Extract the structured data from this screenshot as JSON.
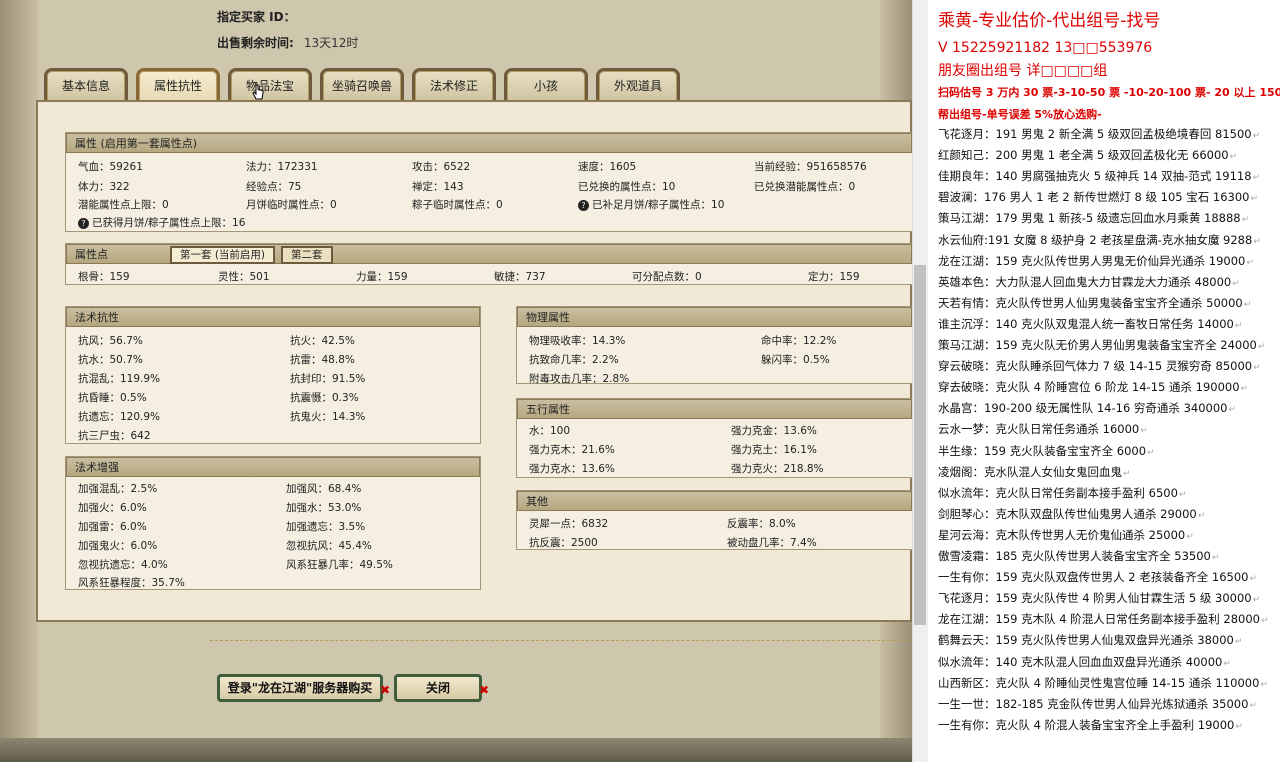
{
  "header": {
    "buyer_label": "指定买家 ID：",
    "remaining_label": "出售剩余时间:",
    "remaining_value": "13天12时"
  },
  "tabs": [
    "基本信息",
    "属性抗性",
    "物品法宝",
    "坐骑召唤兽",
    "法术修正",
    "小孩",
    "外观道具"
  ],
  "attrs": {
    "title": "属性 (启用第一套属性点)",
    "rows": [
      [
        "气血：59261",
        "法力：172331",
        "攻击：6522",
        "速度：1605",
        "当前经验：951658576"
      ],
      [
        "体力：322",
        "经验点：75",
        "禅定：143",
        "已兑换的属性点：10",
        "已兑换潜能属性点：0"
      ],
      [
        "潜能属性点上限：0",
        "月饼临时属性点：0",
        "粽子临时属性点：0",
        "已补足月饼/粽子属性点：10",
        ""
      ]
    ],
    "note": "已获得月饼/粽子属性点上限：16"
  },
  "points": {
    "title": "属性点",
    "tab1": "第一套 (当前启用)",
    "tab2": "第二套",
    "row": [
      "根骨：159",
      "灵性：501",
      "力量：159",
      "敏捷：737",
      "可分配点数：0",
      "定力：159"
    ]
  },
  "resist": {
    "title": "法术抗性",
    "items": [
      [
        "抗风：56.7%",
        "抗火：42.5%"
      ],
      [
        "抗水：50.7%",
        "抗雷：48.8%"
      ],
      [
        "抗混乱：119.9%",
        "抗封印：91.5%"
      ],
      [
        "抗昏睡：0.5%",
        "抗震慑：0.3%"
      ],
      [
        "抗遗忘：120.9%",
        "抗鬼火：14.3%"
      ],
      [
        "抗三尸虫：642",
        ""
      ]
    ]
  },
  "boost": {
    "title": "法术增强",
    "items": [
      [
        "加强混乱：2.5%",
        "加强风：68.4%"
      ],
      [
        "加强火：6.0%",
        "加强水：53.0%"
      ],
      [
        "加强雷：6.0%",
        "加强遗忘：3.5%"
      ],
      [
        "加强鬼火：6.0%",
        "忽视抗风：45.4%"
      ],
      [
        "忽视抗遗忘：4.0%",
        "风系狂暴几率：49.5%"
      ],
      [
        "风系狂暴程度：35.7%",
        ""
      ]
    ]
  },
  "physical": {
    "title": "物理属性",
    "items": [
      [
        "物理吸收率：14.3%",
        "命中率：12.2%"
      ],
      [
        "抗致命几率：2.2%",
        "躲闪率：0.5%"
      ],
      [
        "附毒攻击几率：2.8%",
        ""
      ]
    ]
  },
  "wuxing": {
    "title": "五行属性",
    "items": [
      [
        "水：100",
        "强力克金：13.6%"
      ],
      [
        "强力克木：21.6%",
        "强力克土：16.1%"
      ],
      [
        "强力克水：13.6%",
        "强力克火：218.8%"
      ]
    ]
  },
  "other": {
    "title": "其他",
    "items": [
      [
        "灵犀一点：6832",
        "反震率：8.0%"
      ],
      [
        "抗反震：2500",
        "被动盘几率：7.4%"
      ]
    ]
  },
  "buttons": {
    "login": "登录\"龙在江湖\"服务器购买",
    "close": "关闭"
  },
  "chat": {
    "header": "乘黄-专业估价-代出组号-找号",
    "phone": "V 15225921182  13□□553976",
    "line3": "朋友圈出组号   详□□□□组",
    "line4": "扫码估号 3 万内 30 票-3-10-50 票  -10-20-100 票- 20 以上 150",
    "line5": "帮出组号-单号误差 5%放心选购-",
    "entries": [
      "飞花逐月：191 男鬼 2 新全满 5 级双回孟极绝境春回 81500",
      "红颜知己：200 男鬼 1 老全满 5 级双回孟极化无 66000",
      "佳期良年：140 男腐强抽克火 5 级神兵 14 双抽-范式 19118",
      "碧波澜：176 男人 1 老 2 新传世燃灯 8 级 105 宝石 16300",
      "策马江湖：179 男鬼 1 新孩-5 级遗忘回血水月乘黄 18888",
      "水云仙府:191 女魔 8 级护身 2 老孩星盘满-克水抽女魔 9288",
      "龙在江湖：159 克火队传世男人男鬼无价仙异光通杀 19000",
      "英雄本色：大力队混人回血鬼大力甘霖龙大力通杀 48000",
      "天若有情：克火队传世男人仙男鬼装备宝宝齐全通杀 50000",
      "谁主沉浮：140 克火队双鬼混人统一畜牧日常任务 14000",
      "策马江湖：159 克火队无价男人男仙男鬼装备宝宝齐全 24000",
      "穿云破晓：克火队睡杀回气体力 7 级 14-15 灵猴穷奇 85000",
      "穿去破晓：克火队 4 阶睡宫位 6 阶龙 14-15 通杀 190000",
      "水晶宫：190-200 级无属性队 14-16 穷奇通杀 340000",
      "云水一梦：克火队日常任务通杀 16000",
      "半生缘：159 克火队装备宝宝齐全 6000",
      "凌烟阁：克水队混人女仙女鬼回血鬼",
      "似水流年：克火队日常任务副本接手盈利 6500",
      "剑胆琴心：克木队双盘队传世仙鬼男人通杀 29000",
      "星河云海：克木队传世男人无价鬼仙通杀 25000",
      "傲雪凌霜：185 克火队传世男人装备宝宝齐全 53500",
      "一生有你：159 克火队双盘传世男人 2 老孩装备齐全 16500",
      "飞花逐月：159 克火队传世 4 阶男人仙甘霖生活 5 级 30000",
      "龙在江湖：159 克木队 4 阶混人日常任务副本接手盈利 28000",
      "鹤舞云天：159 克火队传世男人仙鬼双盘异光通杀 38000",
      "似水流年：140 克木队混人回血血双盘异光通杀 40000",
      "山西新区：克火队 4 阶睡仙灵性鬼宫位睡 14-15 通杀 110000",
      "一生一世：182-185 克金队传世男人仙异光炼狱通杀 35000",
      "一生有你：克火队 4 阶混人装备宝宝齐全上手盈利 19000"
    ]
  }
}
